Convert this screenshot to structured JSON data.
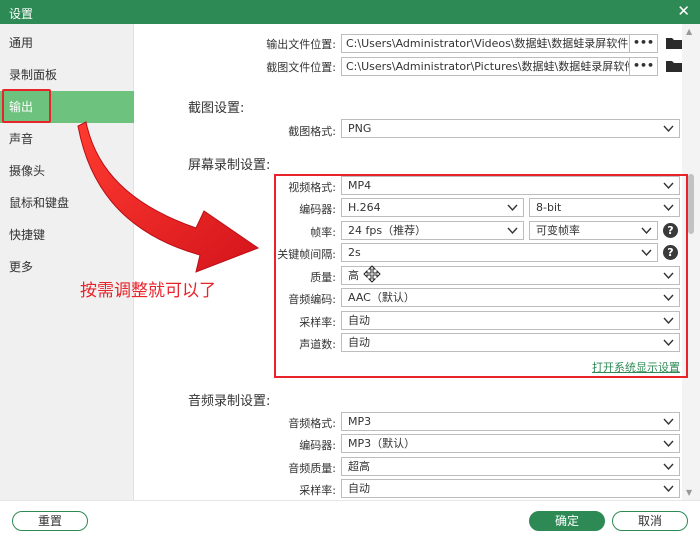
{
  "window": {
    "title": "设置",
    "close_glyph": "✕"
  },
  "sidebar": {
    "items": [
      {
        "label": "通用"
      },
      {
        "label": "录制面板"
      },
      {
        "label": "输出",
        "active": true
      },
      {
        "label": "声音"
      },
      {
        "label": "摄像头"
      },
      {
        "label": "鼠标和键盘"
      },
      {
        "label": "快捷键"
      },
      {
        "label": "更多"
      }
    ]
  },
  "output": {
    "output_location_label": "输出文件位置:",
    "output_location_value": "C:\\Users\\Administrator\\Videos\\数据蛙\\数据蛙录屏软件",
    "screenshot_location_label": "截图文件位置:",
    "screenshot_location_value": "C:\\Users\\Administrator\\Pictures\\数据蛙\\数据蛙录屏软件",
    "browse_glyph": "•••"
  },
  "screenshot_settings": {
    "title": "截图设置:",
    "format_label": "截图格式:",
    "format_value": "PNG"
  },
  "video_settings": {
    "title": "屏幕录制设置:",
    "format_label": "视频格式:",
    "format_value": "MP4",
    "encoder_label": "编码器:",
    "encoder_value": "H.264",
    "bitdepth_value": "8-bit",
    "framerate_label": "帧率:",
    "framerate_value": "24 fps（推荐）",
    "framerate_mode_value": "可变帧率",
    "keyframe_label": "关键帧间隔:",
    "keyframe_value": "2s",
    "quality_label": "质量:",
    "quality_value": "高",
    "audio_codec_label": "音频编码:",
    "audio_codec_value": "AAC（默认）",
    "sample_rate_label": "采样率:",
    "sample_rate_value": "自动",
    "channels_label": "声道数:",
    "channels_value": "自动",
    "display_settings_link": "打开系统显示设置"
  },
  "audio_settings": {
    "title": "音频录制设置:",
    "format_label": "音频格式:",
    "format_value": "MP3",
    "encoder_label": "编码器:",
    "encoder_value": "MP3（默认）",
    "quality_label": "音频质量:",
    "quality_value": "超高",
    "sample_rate_label": "采样率:",
    "sample_rate_value": "自动"
  },
  "annotation": {
    "text": "按需调整就可以了",
    "color": "#e8232a"
  },
  "footer": {
    "reset_label": "重置",
    "ok_label": "确定",
    "cancel_label": "取消"
  },
  "colors": {
    "accent": "#2e8a55",
    "nav_active": "#6dc27e",
    "annotation_red": "#e8232a"
  },
  "icons": {
    "folder": "folder-icon",
    "chevron": "chevron-down-icon",
    "help": "help-icon",
    "move_cursor": "move-cursor-icon",
    "arrow": "red-arrow"
  }
}
